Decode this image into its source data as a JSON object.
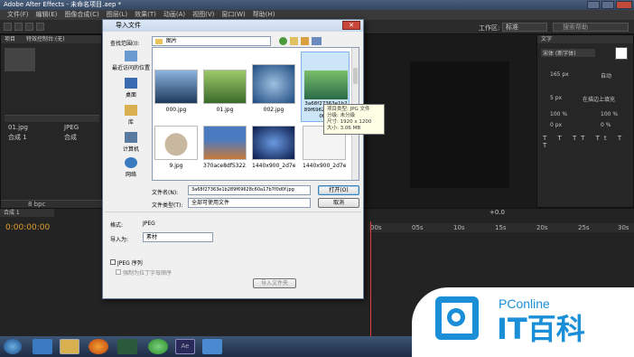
{
  "window": {
    "title": "Adobe After Effects - 未命名项目.aep *"
  },
  "menu": [
    "文件(F)",
    "编辑(E)",
    "图像合成(C)",
    "图层(L)",
    "效果(T)",
    "动画(A)",
    "视图(V)",
    "窗口(W)",
    "帮助(H)"
  ],
  "toolbar": {
    "workspace_label": "工作区:",
    "workspace_value": "标准",
    "search_placeholder": "搜索帮助"
  },
  "left_panel": {
    "tabs": [
      "项目",
      "特效控制台:(无)"
    ],
    "items": [
      {
        "name": "01.jpg",
        "type": "JPEG"
      },
      {
        "name": "合成 1",
        "type": "合成"
      }
    ],
    "bpc": "8 bpc"
  },
  "timeline": {
    "tab": "合成 1",
    "timecode": "0:00:00:00",
    "markers": [
      "00s",
      "05s",
      "10s",
      "15s",
      "20s",
      "25s",
      "30s"
    ],
    "zoom": "+0.0"
  },
  "right_panel": {
    "title": "文字",
    "font_name": "宋体 (新字体)",
    "size_label": "165 px",
    "leading_label": "自动",
    "indent_label": "5 px",
    "stroke_label": "在描边上填充",
    "scale_v": "100 %",
    "scale_h": "100 %",
    "baseline": "0 px",
    "tsume": "0 %"
  },
  "dialog": {
    "title": "导入文件",
    "lookin_label": "查找范围(I):",
    "lookin_value": "图片",
    "places": [
      "最近访问的位置",
      "桌面",
      "库",
      "计算机",
      "网络"
    ],
    "thumbnails": [
      {
        "name": "000.jpg",
        "color": "#4a7fb8"
      },
      {
        "name": "01.jpg",
        "color": "#4f8a3a"
      },
      {
        "name": "002.jpg",
        "color": "#2e6fa8"
      },
      {
        "name": "3a68f27363e1b289...",
        "color": "#3a8f5c"
      },
      {
        "name": "9.jpg",
        "color": "#9c8870"
      },
      {
        "name": "370ace8df5322...",
        "color": "#a36a3a"
      },
      {
        "name": "1440x900_2d7e...",
        "color": "#2a3f7a"
      },
      {
        "name": "1440x900_2d7e...",
        "color": "#e8e8e8"
      }
    ],
    "selected_caption_lines": [
      "3a68f27363e1b2",
      "89f69628c60a1...",
      "0f.jpg"
    ],
    "tooltip_lines": [
      "项目类型: JPG 文件",
      "分级: 未分级",
      "尺寸: 1920 x 1200",
      "大小: 3.06 MB"
    ],
    "filename_label": "文件名(N):",
    "filename_value": "3a68f27363e1b289f69628c60a17b7f0d0f.jpg",
    "filetype_label": "文件类型(T):",
    "filetype_value": "全部可使用文件",
    "open_button": "打开(O)",
    "cancel_button": "取消",
    "format_label": "格式:",
    "format_value": "JPEG",
    "import_as_label": "导入为:",
    "import_as_value": "素材",
    "sequence_label": "JPEG 序列",
    "alpha_label": "强制为拉丁字母顺序",
    "import_folder_button": "导入文件夹"
  },
  "watermark": {
    "brand": "PConline",
    "text": "IT百科"
  }
}
